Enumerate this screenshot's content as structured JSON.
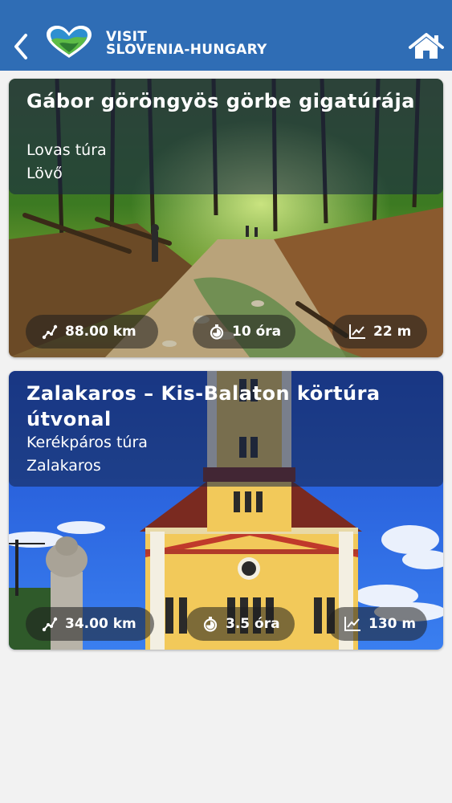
{
  "header": {
    "brand_line1": "VISIT",
    "brand_line2": "SLOVENIA-HUNGARY",
    "background_color": "#2f6db5"
  },
  "icons": {
    "back": "chevron-left-icon",
    "home": "home-icon",
    "distance": "route-icon",
    "duration": "stopwatch-icon",
    "elevation": "chart-line-icon"
  },
  "tours": [
    {
      "title": "Gábor göröngyös görbe gigatúrája",
      "type": "Lovas túra",
      "place": "Lövő",
      "distance": "88.00 km",
      "duration": "10 óra",
      "elevation": "22 m"
    },
    {
      "title": "Zalakaros – Kis-Balaton körtúra útvonal",
      "type": "Kerékpáros túra",
      "place": "Zalakaros",
      "distance": "34.00 km",
      "duration": "3.5 óra",
      "elevation": "130 m"
    }
  ]
}
